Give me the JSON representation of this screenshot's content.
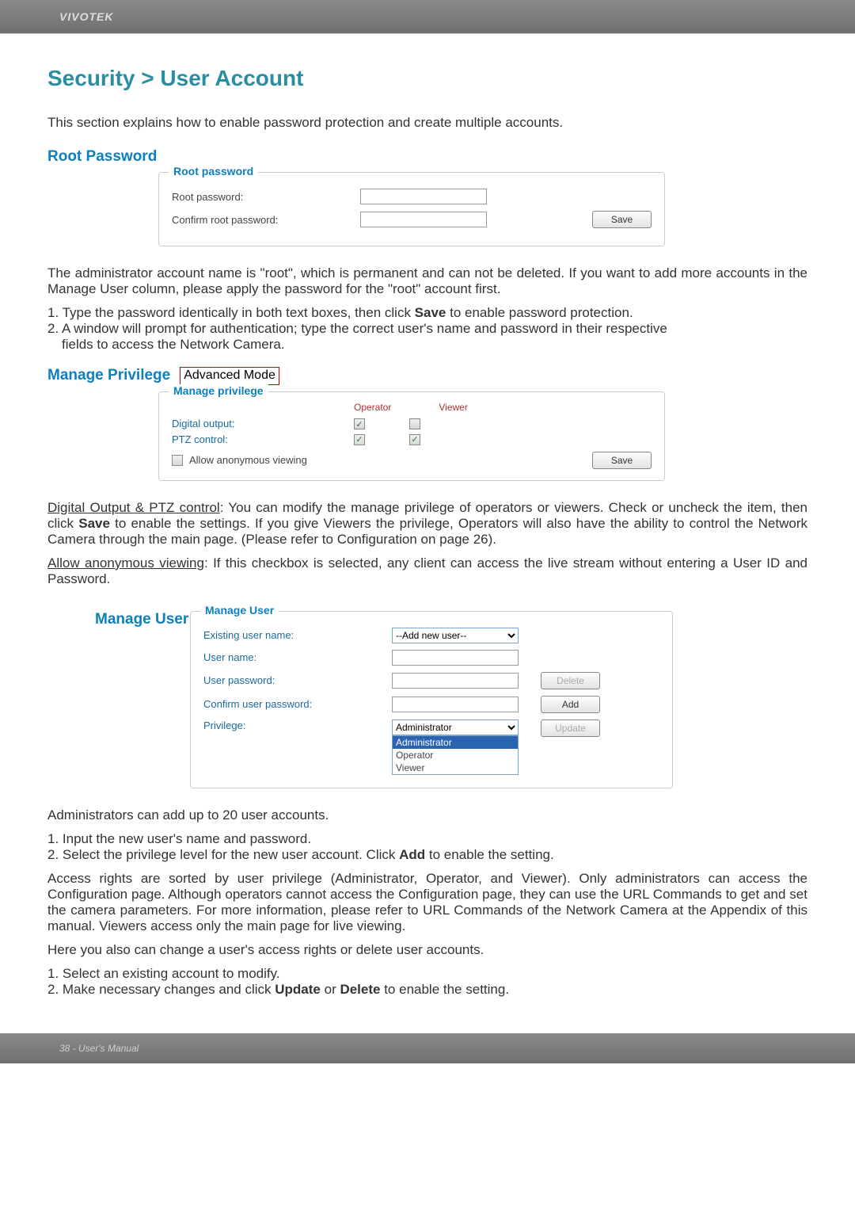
{
  "header": {
    "brand": "VIVOTEK"
  },
  "title": "Security > User Account",
  "intro": "This section explains how to enable password protection and create multiple accounts.",
  "root": {
    "heading": "Root Password",
    "legend": "Root password",
    "label_pw": "Root password:",
    "label_confirm": "Confirm root password:",
    "save": "Save"
  },
  "root_para1": "The administrator account name is \"root\", which is permanent and can not be deleted. If you want to add more accounts in the Manage User column, please apply the password for the \"root\" account first.",
  "root_step1_a": "1. Type the password identically in both text boxes, then click ",
  "root_step1_b": "Save",
  "root_step1_c": " to enable password protection.",
  "root_step2_a": "2. A window will prompt for authentication; type the correct user's name and password in their respective",
  "root_step2_b": "fields to access the Network Camera.",
  "priv": {
    "heading": "Manage Privilege",
    "adv": "Advanced Mode",
    "legend": "Manage privilege",
    "col_operator": "Operator",
    "col_viewer": "Viewer",
    "row_do": "Digital output:",
    "row_ptz": "PTZ control:",
    "allow_anon": "Allow anonymous viewing",
    "save": "Save"
  },
  "priv_para_a": "Digital Output & PTZ control",
  "priv_para_b": ": You can modify the manage privilege of operators or viewers. Check or uncheck the item, then click ",
  "priv_para_c": "Save",
  "priv_para_d": " to enable the settings. If you give Viewers the privilege, Operators will also have the ability to control the Network Camera through the main page. (Please refer to Configuration on page 26).",
  "anon_a": "Allow anonymous viewing",
  "anon_b": ": If this checkbox is selected, any client can access the live stream without entering a User ID and Password.",
  "mu": {
    "heading": "Manage User",
    "legend": "Manage User",
    "label_existing": "Existing user name:",
    "label_uname": "User name:",
    "label_pw": "User password:",
    "label_confirm": "Confirm user password:",
    "label_priv": "Privilege:",
    "btn_delete": "Delete",
    "btn_add": "Add",
    "btn_update": "Update",
    "existing_selected": "--Add new user--",
    "priv_selected": "Administrator",
    "priv_opts": {
      "o1": "Administrator",
      "o2": "Operator",
      "o3": "Viewer"
    }
  },
  "mu_p1": "Administrators can add up to 20 user accounts.",
  "mu_s1": "1. Input the new user's name and password.",
  "mu_s2_a": "2. Select the privilege level for the new user account. Click ",
  "mu_s2_b": "Add",
  "mu_s2_c": " to enable the setting.",
  "mu_p2": "Access rights are sorted by user privilege (Administrator, Operator, and Viewer). Only administrators can access the Configuration page. Although operators cannot access the Configuration page, they can use the URL Commands to get and set the camera parameters. For more information, please refer to URL Commands of the Network Camera at the Appendix of this manual. Viewers access only the main page for live viewing.",
  "mu_p3": "Here you also can change a user's access rights or delete user accounts.",
  "mu_s3": "1. Select an existing account to modify.",
  "mu_s4_a": "2. Make necessary changes and click ",
  "mu_s4_b": "Update",
  "mu_s4_c": " or ",
  "mu_s4_d": "Delete",
  "mu_s4_e": " to enable the setting.",
  "footer": "38 - User's Manual"
}
